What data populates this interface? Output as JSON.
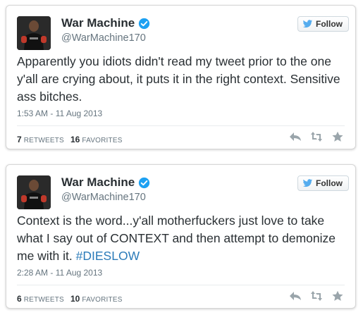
{
  "tweets": [
    {
      "display_name": "War Machine",
      "screen_name": "@WarMachine170",
      "follow_label": "Follow",
      "text": "Apparently you idiots didn't read my tweet prior to the one y'all are crying about, it puts it in the right context. Sensitive ass bitches.",
      "text_hashtag": "",
      "timestamp": "1:53 AM - 11 Aug 2013",
      "retweets": "7",
      "retweets_label": "RETWEETS",
      "favorites": "16",
      "favorites_label": "FAVORITES"
    },
    {
      "display_name": "War Machine",
      "screen_name": "@WarMachine170",
      "follow_label": "Follow",
      "text": "Context is the word...y'all motherfuckers just love to take what I say out of CONTEXT and then attempt to demonize me with it. ",
      "text_hashtag": "#DIESLOW",
      "timestamp": "2:28 AM - 11 Aug 2013",
      "retweets": "6",
      "retweets_label": "RETWEETS",
      "favorites": "10",
      "favorites_label": "FAVORITES"
    }
  ],
  "colors": {
    "link": "#2b7bb9",
    "verified": "#1da1f2",
    "action_icon": "#9aa5ab",
    "twitter_bird": "#55acee"
  },
  "icons": [
    "verified-badge-icon",
    "twitter-bird-icon",
    "reply-icon",
    "retweet-icon",
    "favorite-star-icon"
  ]
}
